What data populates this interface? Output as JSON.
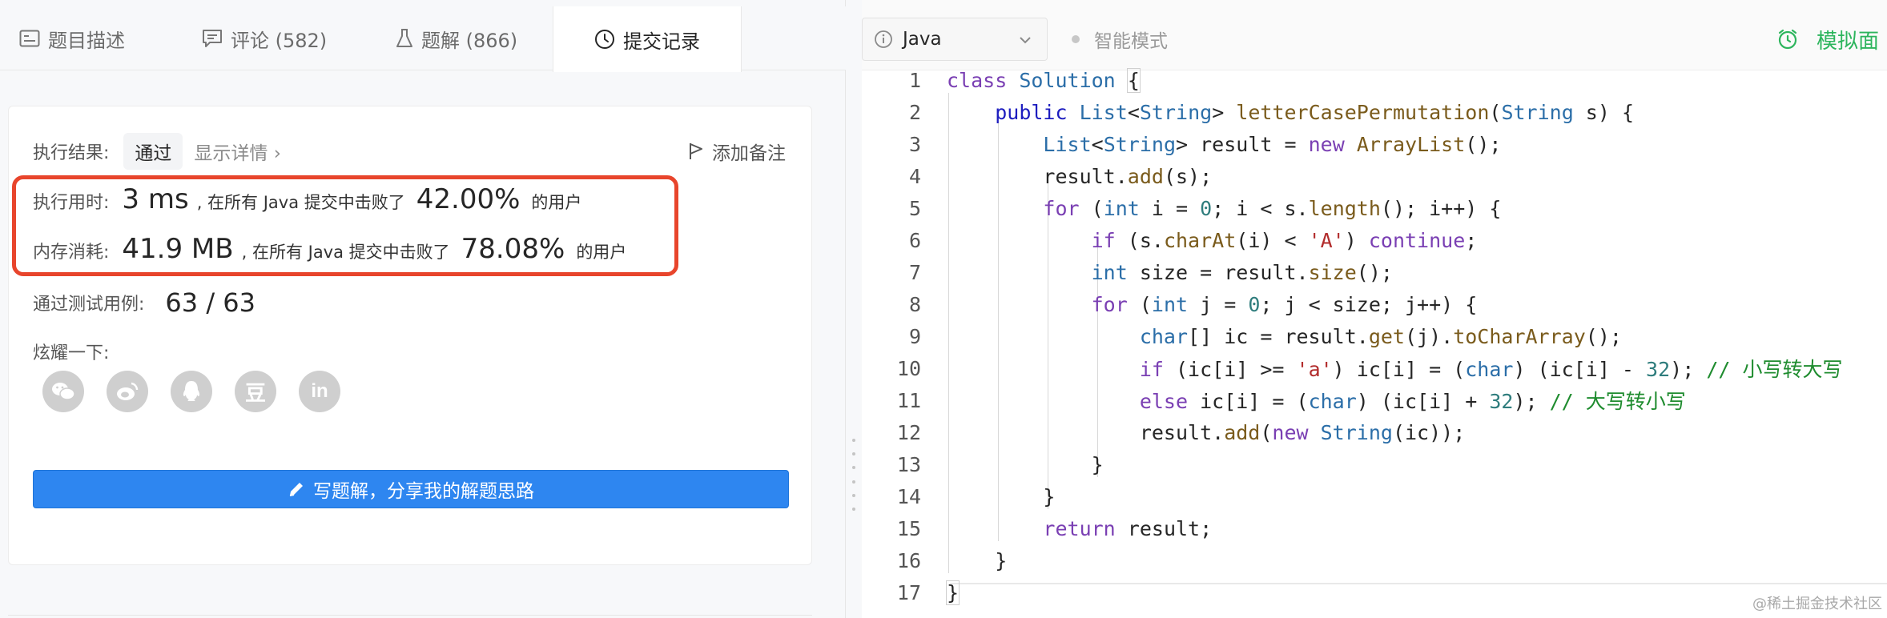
{
  "left_tabs": [
    {
      "label": "题目描述",
      "icon": "description-icon"
    },
    {
      "label": "评论 (582)",
      "icon": "comment-icon"
    },
    {
      "label": "题解 (866)",
      "icon": "flask-icon"
    },
    {
      "label": "提交记录",
      "icon": "clock-icon",
      "active": true
    }
  ],
  "result": {
    "label": "执行结果:",
    "status": "通过",
    "detail_link": "显示详情 ›",
    "note_button": "添加备注"
  },
  "runtime": {
    "label": "执行用时:",
    "value": "3 ms",
    "middle_text": ", 在所有 Java 提交中击败了",
    "percent": "42.00%",
    "suffix": "的用户"
  },
  "memory": {
    "label": "内存消耗:",
    "value": "41.9 MB",
    "middle_text": ", 在所有 Java 提交中击败了",
    "percent": "78.08%",
    "suffix": "的用户"
  },
  "test_cases": {
    "label": "通过测试用例:",
    "value": "63 / 63"
  },
  "share": {
    "title": "炫耀一下:",
    "icons": [
      "wechat-icon",
      "weibo-icon",
      "qq-icon",
      "douban-icon",
      "linkedin-icon"
    ],
    "douban_glyph": "豆",
    "linkedin_glyph": "in"
  },
  "write_solution_button": "写题解，分享我的解题思路",
  "editor_toolbar": {
    "language": "Java",
    "smart_mode": "智能模式",
    "mock_interview": "模拟面"
  },
  "code_lines": [
    "class Solution {",
    "    public List<String> letterCasePermutation(String s) {",
    "        List<String> result = new ArrayList();",
    "        result.add(s);",
    "        for (int i = 0; i < s.length(); i++) {",
    "            if (s.charAt(i) < 'A') continue;",
    "            int size = result.size();",
    "            for (int j = 0; j < size; j++) {",
    "                char[] ic = result.get(j).toCharArray();",
    "                if (ic[i] >= 'a') ic[i] = (char) (ic[i] - 32); // 小写转大写",
    "                else ic[i] = (char) (ic[i] + 32); // 大写转小写",
    "                result.add(new String(ic));",
    "            }",
    "        }",
    "        return result;",
    "    }",
    "}"
  ],
  "watermark": "@稀土掘金技术社区"
}
